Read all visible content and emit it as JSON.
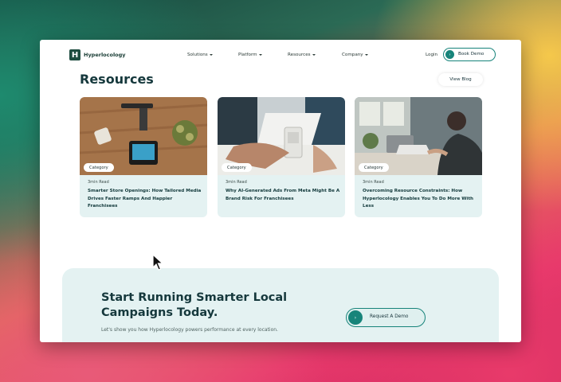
{
  "nav": {
    "logo_letter": "H",
    "brand": "Hyperlocology",
    "items": [
      {
        "label": "Solutions"
      },
      {
        "label": "Platform"
      },
      {
        "label": "Resources"
      },
      {
        "label": "Company"
      }
    ],
    "login": "Login",
    "book_demo": "Book Demo"
  },
  "resources": {
    "title": "Resources",
    "view_blog": "View Blog",
    "cards": [
      {
        "category": "Category",
        "read_time": "3min Read",
        "title": "Smarter Store Openings: How Tailored Media Drives Faster Ramps And Happier Franchisees"
      },
      {
        "category": "Category",
        "read_time": "3min Read",
        "title": "Why AI-Generated Ads From Meta Might Be A Brand Risk For Franchisees"
      },
      {
        "category": "Category",
        "read_time": "3min Read",
        "title": "Overcoming Resource Constraints: How Hyperlocology Enables You To Do More With Less"
      }
    ]
  },
  "cta": {
    "title": "Start Running Smarter Local Campaigns Today.",
    "subtitle": "Let's show you how Hyperlocology powers performance at every location.",
    "button": "Request A Demo"
  },
  "colors": {
    "brand_dark": "#15383c",
    "accent_teal": "#17847a",
    "card_bg": "#e4f2f2"
  }
}
